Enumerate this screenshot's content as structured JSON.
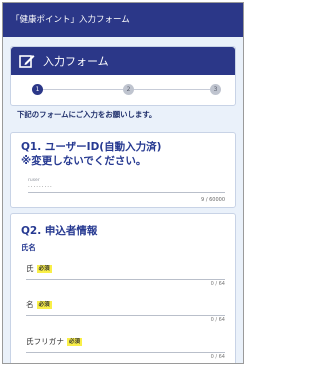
{
  "header": {
    "title": "「健康ポイント」入力フォーム"
  },
  "form": {
    "title": "入力フォーム",
    "icon": "edit-icon",
    "steps": [
      "1",
      "2",
      "3"
    ],
    "current_step": 1
  },
  "intro": "下記のフォームにご入力をお願いします。",
  "q1": {
    "title_line1": "Q1. ユーザーID(自動入力済)",
    "title_line2": "※変更しないでください。",
    "field_tag": "ruser",
    "value": "·········",
    "count": "9 / 60000"
  },
  "q2": {
    "title": "Q2. 申込者情報",
    "subtitle": "氏名",
    "fields": [
      {
        "label": "氏",
        "required": "必須",
        "count": "0 / 64"
      },
      {
        "label": "名",
        "required": "必須",
        "count": "0 / 64"
      },
      {
        "label": "氏フリガナ",
        "required": "必須",
        "count": "0 / 64"
      }
    ]
  },
  "colors": {
    "header_bg": "#2b3788",
    "page_bg": "#eaf1fa",
    "accent": "#263991",
    "required_bg": "#f9ef48"
  }
}
